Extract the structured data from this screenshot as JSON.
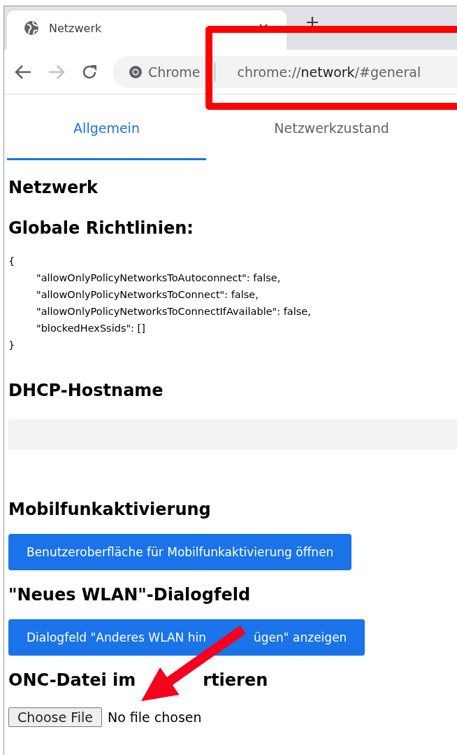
{
  "browser_tab": {
    "title": "Netzwerk"
  },
  "address_bar": {
    "origin_label": "Chrome",
    "url_scheme": "chrome://",
    "url_host": "network",
    "url_path": "/#general"
  },
  "tabs": [
    {
      "label": "Allgemein",
      "selected": true
    },
    {
      "label": "Netzwerkzustand",
      "selected": false
    }
  ],
  "page_heading": "Netzwerk",
  "sections": [
    {
      "kind": "code",
      "title": "Globale Richtlinien:",
      "code": {
        "open": "{",
        "entries": [
          "\"allowOnlyPolicyNetworksToAutoconnect\": false,",
          "\"allowOnlyPolicyNetworksToConnect\": false,",
          "\"allowOnlyPolicyNetworksToConnectIfAvailable\": false,",
          "\"blockedHexSsids\": []"
        ],
        "close": "}"
      }
    },
    {
      "kind": "field",
      "title": "DHCP-Hostname"
    },
    {
      "kind": "button",
      "title": "Mobilfunkaktivierung",
      "button": "Benutzeroberfläche für Mobilfunkaktivierung öffnen"
    },
    {
      "kind": "button",
      "title": "\"Neues WLAN\"-Dialogfeld",
      "button": "Dialogfeld \"Anderes WLAN hin",
      "button_after_arrow": "ügen\" anzeigen"
    },
    {
      "kind": "file",
      "title": "ONC-Datei im",
      "title_after_arrow": "rtieren",
      "button": "Choose File",
      "status": "No file chosen"
    }
  ],
  "annotations": {
    "highlight_box": true,
    "pointer_arrow": true
  }
}
